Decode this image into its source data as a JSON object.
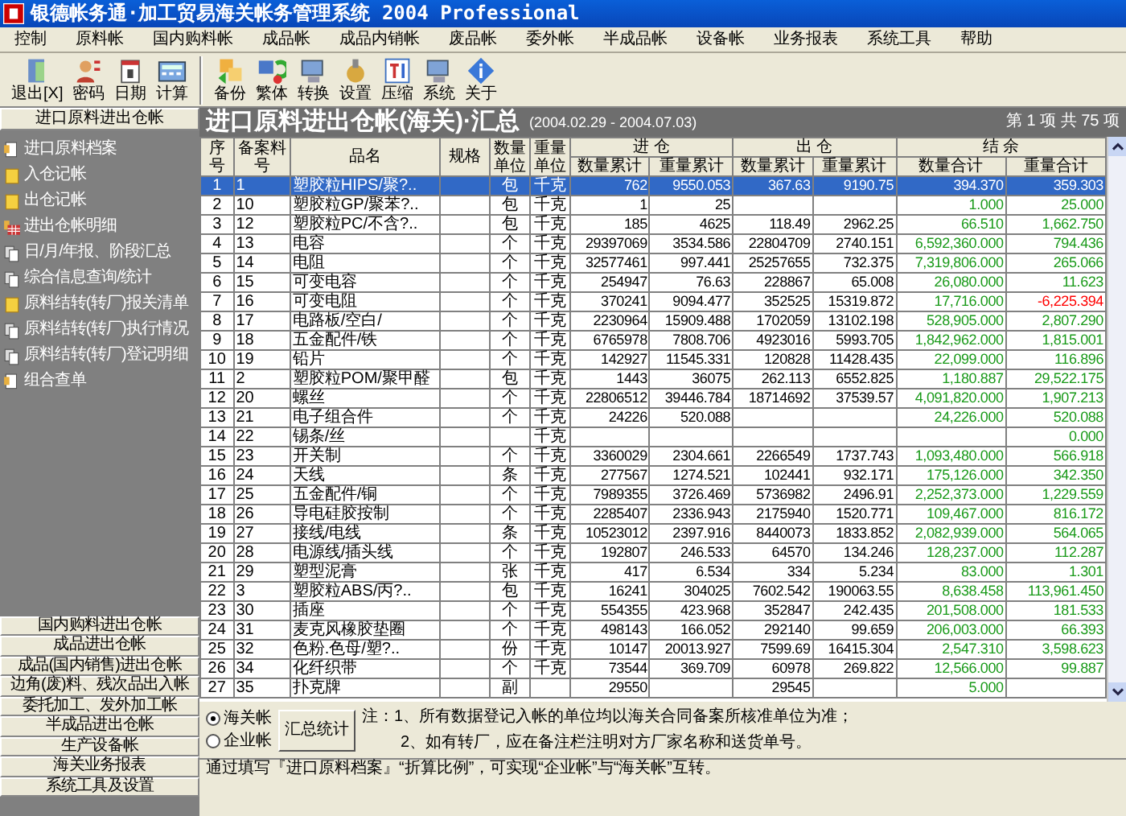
{
  "window": {
    "title": "银德帐务通·加工贸易海关帐务管理系统 2004 Professional"
  },
  "menu": [
    "控制",
    "原料帐",
    "国内购料帐",
    "成品帐",
    "成品内销帐",
    "废品帐",
    "委外帐",
    "半成品帐",
    "设备帐",
    "业务报表",
    "系统工具",
    "帮助"
  ],
  "toolbar": [
    "退出[X]",
    "密码",
    "日期",
    "计算",
    "备份",
    "繁体",
    "转换",
    "设置",
    "压缩",
    "系统",
    "关于"
  ],
  "sidebar": {
    "heading": "进口原料进出仓帐",
    "items": [
      {
        "label": "进口原料档案",
        "kind": "file"
      },
      {
        "label": "入仓记帐",
        "kind": "entry"
      },
      {
        "label": "出仓记帐",
        "kind": "entry"
      },
      {
        "label": "进出仓帐明细",
        "kind": "table"
      },
      {
        "label": "日/月/年报、阶段汇总",
        "kind": "report"
      },
      {
        "label": "综合信息查询/统计",
        "kind": "report"
      },
      {
        "label": "原料结转(转厂)报关清单",
        "kind": "entry"
      },
      {
        "label": "原料结转(转厂)执行情况",
        "kind": "report"
      },
      {
        "label": "原料结转(转厂)登记明细",
        "kind": "report"
      },
      {
        "label": "组合查单",
        "kind": "file"
      }
    ],
    "sections": [
      "国内购料进出仓帐",
      "成品进出仓帐",
      "成品(国内销售)进出仓帐",
      "边角(废)料、残次品出入帐",
      "委托加工、发外加工帐",
      "半成品进出仓帐",
      "生产设备帐",
      "海关业务报表",
      "系统工具及设置"
    ]
  },
  "report": {
    "title": "进口原料进出仓帐(海关)·汇总",
    "period": "(2004.02.29 - 2004.07.03)",
    "position": "第 1 项 共 75 项"
  },
  "table": {
    "columns": [
      "序号",
      "备案料号",
      "品名",
      "规格",
      "数量单位",
      "重量单位"
    ],
    "groups": [
      {
        "label": "进 仓",
        "columns": [
          "数量累计",
          "重量累计"
        ]
      },
      {
        "label": "出 仓",
        "columns": [
          "数量累计",
          "重量累计"
        ]
      },
      {
        "label": "结 余",
        "columns": [
          "数量合计",
          "重量合计"
        ]
      }
    ],
    "rows": [
      {
        "cells": [
          "1",
          "1",
          "塑胶粒HIPS/聚?..",
          "",
          "包",
          "千克",
          "762",
          "9550.053",
          "367.63",
          "9190.75",
          "394.370",
          "359.303"
        ],
        "selected": true,
        "negative": false
      },
      {
        "cells": [
          "2",
          "10",
          "塑胶粒GP/聚苯?..",
          "",
          "包",
          "千克",
          "1",
          "25",
          "",
          "",
          "1.000",
          "25.000"
        ],
        "selected": false,
        "negative": false
      },
      {
        "cells": [
          "3",
          "12",
          "塑胶粒PC/不含?..",
          "",
          "包",
          "千克",
          "185",
          "4625",
          "118.49",
          "2962.25",
          "66.510",
          "1,662.750"
        ],
        "selected": false,
        "negative": false
      },
      {
        "cells": [
          "4",
          "13",
          "电容",
          "",
          "个",
          "千克",
          "29397069",
          "3534.586",
          "22804709",
          "2740.151",
          "6,592,360.000",
          "794.436"
        ],
        "selected": false,
        "negative": false
      },
      {
        "cells": [
          "5",
          "14",
          "电阻",
          "",
          "个",
          "千克",
          "32577461",
          "997.441",
          "25257655",
          "732.375",
          "7,319,806.000",
          "265.066"
        ],
        "selected": false,
        "negative": false
      },
      {
        "cells": [
          "6",
          "15",
          "可变电容",
          "",
          "个",
          "千克",
          "254947",
          "76.63",
          "228867",
          "65.008",
          "26,080.000",
          "11.623"
        ],
        "selected": false,
        "negative": false
      },
      {
        "cells": [
          "7",
          "16",
          "可变电阻",
          "",
          "个",
          "千克",
          "370241",
          "9094.477",
          "352525",
          "15319.872",
          "17,716.000",
          "-6,225.394"
        ],
        "selected": false,
        "negative": true
      },
      {
        "cells": [
          "8",
          "17",
          "电路板/空白/",
          "",
          "个",
          "千克",
          "2230964",
          "15909.488",
          "1702059",
          "13102.198",
          "528,905.000",
          "2,807.290"
        ],
        "selected": false,
        "negative": false
      },
      {
        "cells": [
          "9",
          "18",
          "五金配件/铁",
          "",
          "个",
          "千克",
          "6765978",
          "7808.706",
          "4923016",
          "5993.705",
          "1,842,962.000",
          "1,815.001"
        ],
        "selected": false,
        "negative": false
      },
      {
        "cells": [
          "10",
          "19",
          "铅片",
          "",
          "个",
          "千克",
          "142927",
          "11545.331",
          "120828",
          "11428.435",
          "22,099.000",
          "116.896"
        ],
        "selected": false,
        "negative": false
      },
      {
        "cells": [
          "11",
          "2",
          "塑胶粒POM/聚甲醛",
          "",
          "包",
          "千克",
          "1443",
          "36075",
          "262.113",
          "6552.825",
          "1,180.887",
          "29,522.175"
        ],
        "selected": false,
        "negative": false
      },
      {
        "cells": [
          "12",
          "20",
          "螺丝",
          "",
          "个",
          "千克",
          "22806512",
          "39446.784",
          "18714692",
          "37539.57",
          "4,091,820.000",
          "1,907.213"
        ],
        "selected": false,
        "negative": false
      },
      {
        "cells": [
          "13",
          "21",
          "电子组合件",
          "",
          "个",
          "千克",
          "24226",
          "520.088",
          "",
          "",
          "24,226.000",
          "520.088"
        ],
        "selected": false,
        "negative": false
      },
      {
        "cells": [
          "14",
          "22",
          "锡条/丝",
          "",
          "",
          "千克",
          "",
          "",
          "",
          "",
          "",
          "0.000"
        ],
        "selected": false,
        "negative": false
      },
      {
        "cells": [
          "15",
          "23",
          "开关制",
          "",
          "个",
          "千克",
          "3360029",
          "2304.661",
          "2266549",
          "1737.743",
          "1,093,480.000",
          "566.918"
        ],
        "selected": false,
        "negative": false
      },
      {
        "cells": [
          "16",
          "24",
          "天线",
          "",
          "条",
          "千克",
          "277567",
          "1274.521",
          "102441",
          "932.171",
          "175,126.000",
          "342.350"
        ],
        "selected": false,
        "negative": false
      },
      {
        "cells": [
          "17",
          "25",
          "五金配件/铜",
          "",
          "个",
          "千克",
          "7989355",
          "3726.469",
          "5736982",
          "2496.91",
          "2,252,373.000",
          "1,229.559"
        ],
        "selected": false,
        "negative": false
      },
      {
        "cells": [
          "18",
          "26",
          "导电硅胶按制",
          "",
          "个",
          "千克",
          "2285407",
          "2336.943",
          "2175940",
          "1520.771",
          "109,467.000",
          "816.172"
        ],
        "selected": false,
        "negative": false
      },
      {
        "cells": [
          "19",
          "27",
          "接线/电线",
          "",
          "条",
          "千克",
          "10523012",
          "2397.916",
          "8440073",
          "1833.852",
          "2,082,939.000",
          "564.065"
        ],
        "selected": false,
        "negative": false
      },
      {
        "cells": [
          "20",
          "28",
          "电源线/插头线",
          "",
          "个",
          "千克",
          "192807",
          "246.533",
          "64570",
          "134.246",
          "128,237.000",
          "112.287"
        ],
        "selected": false,
        "negative": false
      },
      {
        "cells": [
          "21",
          "29",
          "塑型泥膏",
          "",
          "张",
          "千克",
          "417",
          "6.534",
          "334",
          "5.234",
          "83.000",
          "1.301"
        ],
        "selected": false,
        "negative": false
      },
      {
        "cells": [
          "22",
          "3",
          "塑胶粒ABS/丙?..",
          "",
          "包",
          "千克",
          "16241",
          "304025",
          "7602.542",
          "190063.55",
          "8,638.458",
          "113,961.450"
        ],
        "selected": false,
        "negative": false
      },
      {
        "cells": [
          "23",
          "30",
          "插座",
          "",
          "个",
          "千克",
          "554355",
          "423.968",
          "352847",
          "242.435",
          "201,508.000",
          "181.533"
        ],
        "selected": false,
        "negative": false
      },
      {
        "cells": [
          "24",
          "31",
          "麦克风橡胶垫圈",
          "",
          "个",
          "千克",
          "498143",
          "166.052",
          "292140",
          "99.659",
          "206,003.000",
          "66.393"
        ],
        "selected": false,
        "negative": false
      },
      {
        "cells": [
          "25",
          "32",
          "色粉.色母/塑?..",
          "",
          "份",
          "千克",
          "10147",
          "20013.927",
          "7599.69",
          "16415.304",
          "2,547.310",
          "3,598.623"
        ],
        "selected": false,
        "negative": false
      },
      {
        "cells": [
          "26",
          "34",
          "化纤织带",
          "",
          "个",
          "千克",
          "73544",
          "369.709",
          "60978",
          "269.822",
          "12,566.000",
          "99.887"
        ],
        "selected": false,
        "negative": false
      },
      {
        "cells": [
          "27",
          "35",
          "扑克牌",
          "",
          "副",
          "",
          "29550",
          "",
          "29545",
          "",
          "5.000",
          ""
        ],
        "selected": false,
        "negative": false
      }
    ]
  },
  "footer": {
    "options": [
      {
        "label": "海关帐",
        "selected": true
      },
      {
        "label": "企业帐",
        "selected": false
      }
    ],
    "button": "汇总统计",
    "notes": [
      "注：1、所有数据登记入帐的单位均以海关合同备案所核准单位为准；",
      "2、如有转厂，应在备注栏注明对方厂家名称和送货单号。"
    ]
  },
  "status_bar": "通过填写『进口原料档案』“折算比例”，可实现“企业帐”与“海关帐”互转。"
}
